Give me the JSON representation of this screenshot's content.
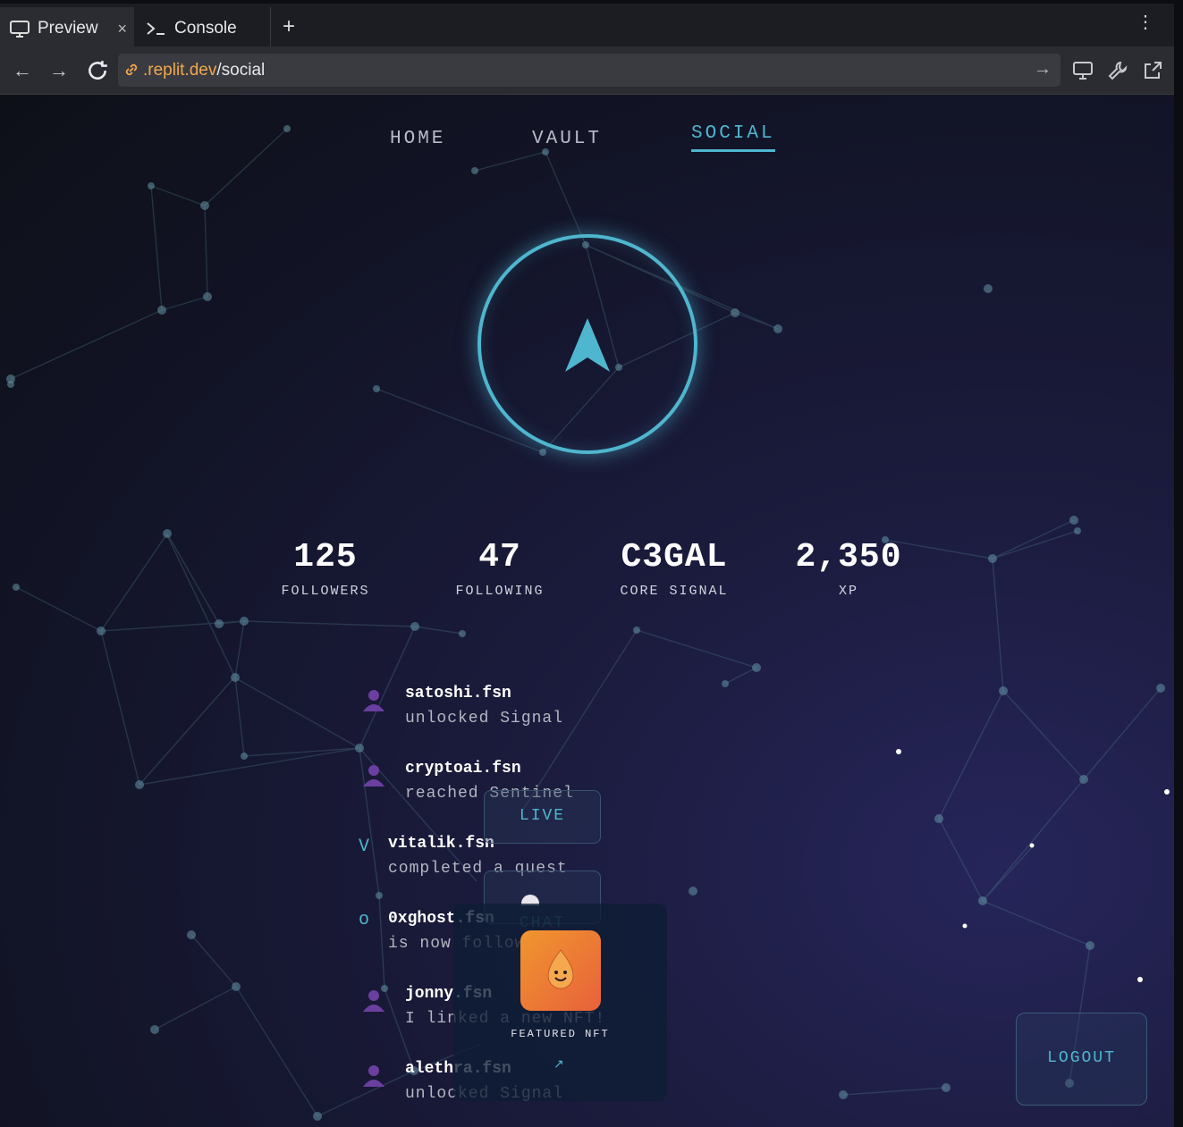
{
  "browser": {
    "tabs": [
      {
        "label": "Preview",
        "icon": "monitor-icon",
        "active": true
      },
      {
        "label": "Console",
        "icon": "terminal-icon",
        "active": false
      }
    ],
    "new_tab_label": "+",
    "close_label": "×",
    "url": {
      "domain": ".replit.dev",
      "path": "/social"
    }
  },
  "nav": {
    "items": [
      {
        "label": "HOME"
      },
      {
        "label": "VAULT"
      },
      {
        "label": "SOCIAL",
        "active": true
      }
    ]
  },
  "stats": [
    {
      "value": "125",
      "label": "FOLLOWERS"
    },
    {
      "value": "47",
      "label": "FOLLOWING"
    },
    {
      "value": "C3GAL",
      "label": "CORE SIGNAL"
    },
    {
      "value": "2,350",
      "label": "XP"
    }
  ],
  "feed": [
    {
      "name": "satoshi.fsn",
      "action": "unlocked Signal",
      "marker": "avatar"
    },
    {
      "name": "cryptoai.fsn",
      "action": "reached Sentinel",
      "marker": "avatar"
    },
    {
      "name": "vitalik.fsn",
      "action": "completed a quest",
      "marker": "V"
    },
    {
      "name": "0xghost.fsn",
      "action": "is now following you",
      "marker": "o"
    },
    {
      "name": "jonny.fsn",
      "action": "I linked a new NFT!",
      "marker": "avatar"
    },
    {
      "name": "alethra.fsn",
      "action": "unlocked Signal",
      "marker": "avatar"
    }
  ],
  "floating": {
    "live_label": "LIVE",
    "chat_label": "CHAT",
    "nft_label": "FEATURED NFT",
    "nft_link": "↗"
  },
  "logout_label": "LOGOUT",
  "colors": {
    "accent": "#4fb6cf",
    "url_domain": "#f2a74b",
    "nft": "#f0962f",
    "avatar": "#6b3fa0"
  }
}
